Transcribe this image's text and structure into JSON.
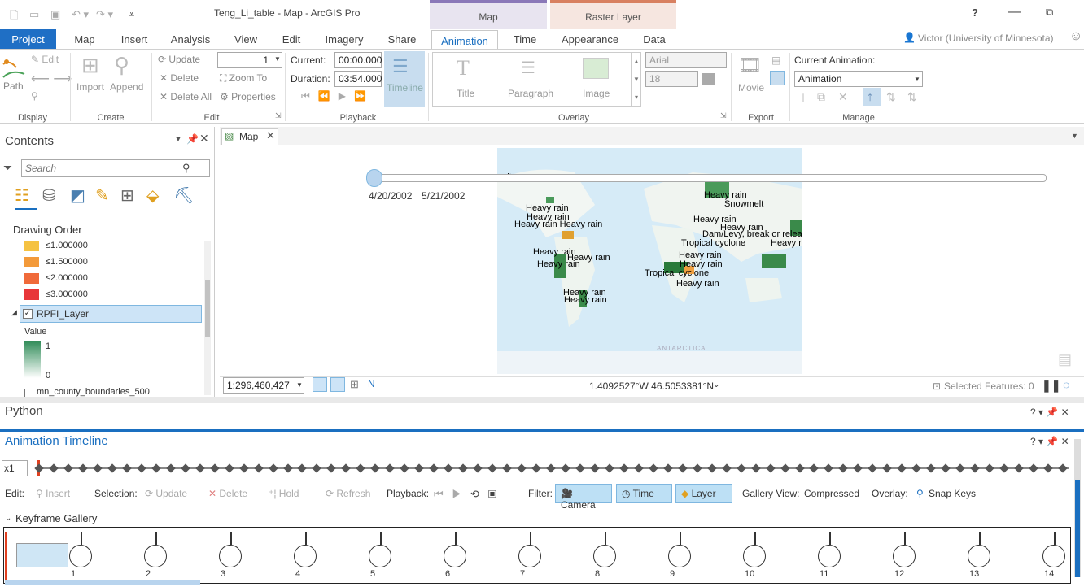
{
  "app": {
    "title": "Teng_Li_table - Map - ArcGIS Pro",
    "user": "Victor (University of Minnesota)",
    "help": "?"
  },
  "context_tabs": {
    "map": "Map",
    "raster": "Raster Layer"
  },
  "tabs": [
    "Project",
    "Map",
    "Insert",
    "Analysis",
    "View",
    "Edit",
    "Imagery",
    "Share",
    "Animation",
    "Time",
    "Appearance",
    "Data"
  ],
  "ribbon": {
    "display": {
      "label": "Display",
      "path": "Path",
      "edit": "Edit"
    },
    "create": {
      "label": "Create",
      "import": "Import",
      "append": "Append"
    },
    "edit": {
      "label": "Edit",
      "update": "Update",
      "delete": "Delete",
      "delete_all": "Delete All",
      "zoom_to": "Zoom To",
      "properties": "Properties",
      "spin_value": "1"
    },
    "playback": {
      "label": "Playback",
      "current_label": "Current:",
      "current_value": "00:00.000",
      "duration_label": "Duration:",
      "duration_value": "03:54.000",
      "timeline": "Timeline"
    },
    "overlay": {
      "label": "Overlay",
      "title": "Title",
      "paragraph": "Paragraph",
      "image": "Image",
      "font": "Arial",
      "size": "18"
    },
    "export": {
      "label": "Export",
      "movie": "Movie"
    },
    "manage": {
      "label": "Manage",
      "current_animation_label": "Current Animation:",
      "current_animation_value": "Animation"
    }
  },
  "contents": {
    "title": "Contents",
    "search_placeholder": "Search",
    "drawing_order": "Drawing Order",
    "legend": [
      "≤1.000000",
      "≤1.500000",
      "≤2.000000",
      "≤3.000000"
    ],
    "legend_colors": [
      "#f5c242",
      "#f39a3a",
      "#f06a3a",
      "#e8363a"
    ],
    "layer": "RPFI_Layer",
    "value_label": "Value",
    "value_high": "1",
    "value_low": "0",
    "next_layer": "mn_county_boundaries_500"
  },
  "map": {
    "tab": "Map",
    "time_start": "4/20/2002",
    "time_end": "5/21/2002",
    "scale": "1:296,460,427",
    "coords": "1.4092527°W 46.5053381°N",
    "selected": "Selected Features: 0",
    "labels": [
      "nelt",
      "Heavy rain",
      "Heavy rain",
      "Heavy rain Heavy rain",
      "Heavy rain",
      "Snowmelt",
      "Heavy rain",
      "Heavy rain",
      "Dam/Levy, break or releas",
      "Tropical cyclone",
      "Heavy rai",
      "Heavy rain",
      "Heavy rain",
      "Heavy rain",
      "Heavy rain",
      "Heavy rain",
      "Tropical cyclone",
      "Heavy rain",
      "Heavy rain",
      "Heavy rain"
    ],
    "antarctica": "ANTARCTICA"
  },
  "python": {
    "title": "Python"
  },
  "timeline": {
    "title": "Animation Timeline",
    "speed": "x1",
    "edit_label": "Edit:",
    "insert": "Insert",
    "selection_label": "Selection:",
    "update": "Update",
    "delete": "Delete",
    "hold": "Hold",
    "refresh": "Refresh",
    "playback_label": "Playback:",
    "filter_label": "Filter:",
    "camera": "Camera",
    "time": "Time",
    "layer": "Layer",
    "gallery_view_label": "Gallery View:",
    "gallery_view_value": "Compressed",
    "overlay_label": "Overlay:",
    "snap_keys": "Snap Keys",
    "keyframe_gallery": "Keyframe Gallery",
    "keyframes": [
      "1",
      "2",
      "3",
      "4",
      "5",
      "6",
      "7",
      "8",
      "9",
      "10",
      "11",
      "12",
      "13",
      "14"
    ]
  }
}
